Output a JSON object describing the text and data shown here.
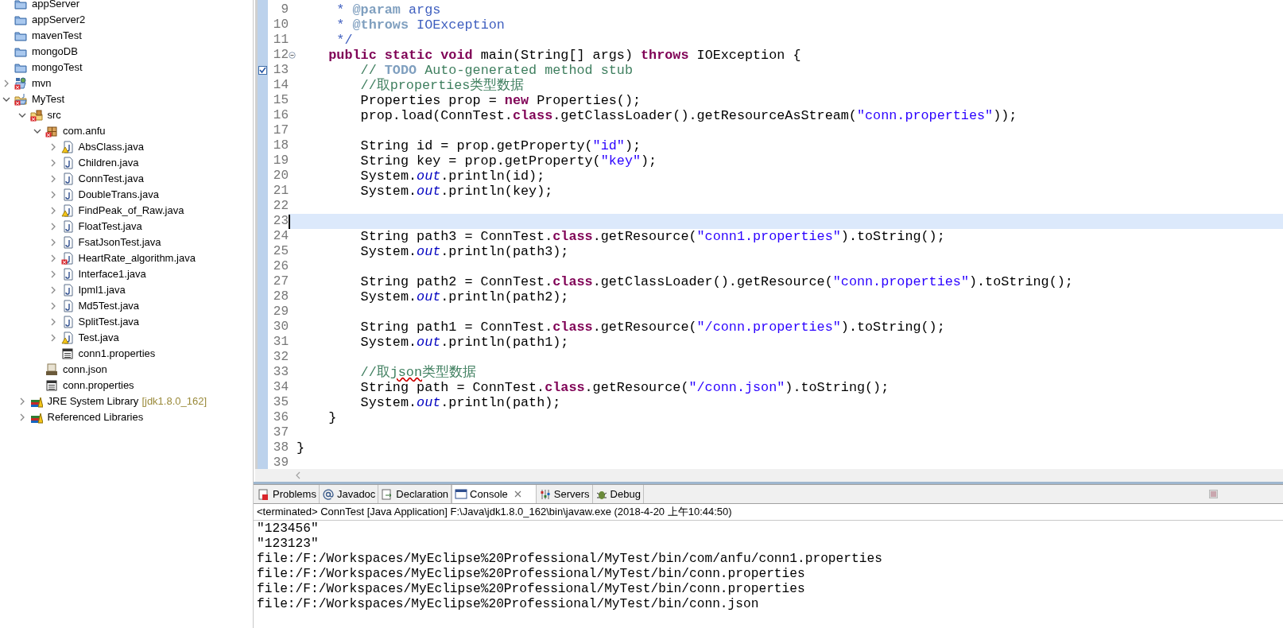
{
  "tree": [
    {
      "label": "appServer",
      "kind": "closed_project",
      "error": false,
      "warning": false
    },
    {
      "label": "appServer2",
      "kind": "closed_project",
      "error": false,
      "warning": false
    },
    {
      "label": "mavenTest",
      "kind": "closed_project",
      "error": false,
      "warning": false
    },
    {
      "label": "mongoDB",
      "kind": "closed_project",
      "error": false,
      "warning": false
    },
    {
      "label": "mongoTest",
      "kind": "closed_project",
      "error": false,
      "warning": false
    },
    {
      "label": "mvn",
      "kind": "maven_project",
      "error": true,
      "warning": false,
      "expanded": false
    },
    {
      "label": "MyTest",
      "kind": "java_project",
      "error": true,
      "warning": false,
      "expanded": true,
      "children": [
        {
          "label": "src",
          "kind": "source_folder",
          "error": true,
          "warning": false,
          "expanded": true,
          "children": [
            {
              "label": "com.anfu",
              "kind": "package",
              "error": true,
              "warning": false,
              "expanded": true,
              "children": [
                {
                  "label": "AbsClass.java",
                  "kind": "java",
                  "error": false,
                  "warning": true,
                  "expanded": false
                },
                {
                  "label": "Children.java",
                  "kind": "java",
                  "error": false,
                  "warning": false,
                  "expanded": false
                },
                {
                  "label": "ConnTest.java",
                  "kind": "java",
                  "error": false,
                  "warning": false,
                  "expanded": false
                },
                {
                  "label": "DoubleTrans.java",
                  "kind": "java",
                  "error": false,
                  "warning": false,
                  "expanded": false
                },
                {
                  "label": "FindPeak_of_Raw.java",
                  "kind": "java",
                  "error": false,
                  "warning": true,
                  "expanded": false
                },
                {
                  "label": "FloatTest.java",
                  "kind": "java",
                  "error": false,
                  "warning": false,
                  "expanded": false
                },
                {
                  "label": "FsatJsonTest.java",
                  "kind": "java",
                  "error": false,
                  "warning": false,
                  "expanded": false
                },
                {
                  "label": "HeartRate_algorithm.java",
                  "kind": "java",
                  "error": true,
                  "warning": false,
                  "expanded": false
                },
                {
                  "label": "Interface1.java",
                  "kind": "java",
                  "error": false,
                  "warning": false,
                  "expanded": false
                },
                {
                  "label": "Ipml1.java",
                  "kind": "java",
                  "error": false,
                  "warning": false,
                  "expanded": false
                },
                {
                  "label": "Md5Test.java",
                  "kind": "java",
                  "error": false,
                  "warning": false,
                  "expanded": false
                },
                {
                  "label": "SplitTest.java",
                  "kind": "java",
                  "error": false,
                  "warning": false,
                  "expanded": false
                },
                {
                  "label": "Test.java",
                  "kind": "java",
                  "error": false,
                  "warning": true,
                  "expanded": false
                },
                {
                  "label": "conn1.properties",
                  "kind": "properties",
                  "error": false,
                  "warning": false
                }
              ]
            },
            {
              "label": "conn.json",
              "kind": "json",
              "error": false,
              "warning": false
            },
            {
              "label": "conn.properties",
              "kind": "properties",
              "error": false,
              "warning": false
            }
          ]
        },
        {
          "label": "JRE System Library",
          "decoration": "[jdk1.8.0_162]",
          "kind": "library",
          "error": false,
          "warning": false,
          "expanded": false
        },
        {
          "label": "Referenced Libraries",
          "kind": "library",
          "error": false,
          "warning": false,
          "expanded": false
        }
      ]
    }
  ],
  "editor": {
    "lines": [
      {
        "n": "9",
        "current": false,
        "tokens": [
          {
            "kind": "javadoc",
            "text": "     * "
          },
          {
            "kind": "javadoc_tag",
            "text": "@param"
          },
          {
            "kind": "javadoc",
            "text": " args"
          }
        ]
      },
      {
        "n": "10",
        "current": false,
        "tokens": [
          {
            "kind": "javadoc",
            "text": "     * "
          },
          {
            "kind": "javadoc_tag",
            "text": "@throws"
          },
          {
            "kind": "javadoc",
            "text": " IOException"
          }
        ]
      },
      {
        "n": "11",
        "current": false,
        "tokens": [
          {
            "kind": "javadoc",
            "text": "     */"
          }
        ]
      },
      {
        "n": "12",
        "current": false,
        "annotation": {
          "kind": "fold"
        },
        "tokens": [
          {
            "kind": "keyword",
            "text": "    public static void"
          },
          {
            "kind": "plain",
            "text": " main(String[] args) "
          },
          {
            "kind": "keyword",
            "text": "throws"
          },
          {
            "kind": "plain",
            "text": " IOException {"
          }
        ]
      },
      {
        "n": "13",
        "current": false,
        "annotation": {
          "kind": "task"
        },
        "tokens": [
          {
            "kind": "comment",
            "text": "        // "
          },
          {
            "kind": "task_tag",
            "text": "TODO"
          },
          {
            "kind": "comment",
            "text": " Auto-generated method stub"
          }
        ]
      },
      {
        "n": "14",
        "current": false,
        "tokens": [
          {
            "kind": "comment",
            "text": "        //取properties类型数据"
          }
        ]
      },
      {
        "n": "15",
        "current": false,
        "tokens": [
          {
            "kind": "plain",
            "text": "        Properties prop = "
          },
          {
            "kind": "keyword",
            "text": "new"
          },
          {
            "kind": "plain",
            "text": " Properties();"
          }
        ]
      },
      {
        "n": "16",
        "current": false,
        "tokens": [
          {
            "kind": "plain",
            "text": "        prop.load(ConnTest."
          },
          {
            "kind": "keyword",
            "text": "class"
          },
          {
            "kind": "plain",
            "text": ".getClassLoader().getResourceAsStream("
          },
          {
            "kind": "string",
            "text": "\"conn.properties\""
          },
          {
            "kind": "plain",
            "text": "));"
          }
        ]
      },
      {
        "n": "17",
        "current": false
      },
      {
        "n": "18",
        "current": false,
        "tokens": [
          {
            "kind": "plain",
            "text": "        String id = prop.getProperty("
          },
          {
            "kind": "string",
            "text": "\"id\""
          },
          {
            "kind": "plain",
            "text": ");"
          }
        ]
      },
      {
        "n": "19",
        "current": false,
        "tokens": [
          {
            "kind": "plain",
            "text": "        String key = prop.getProperty("
          },
          {
            "kind": "string",
            "text": "\"key\""
          },
          {
            "kind": "plain",
            "text": ");"
          }
        ]
      },
      {
        "n": "20",
        "current": false,
        "tokens": [
          {
            "kind": "plain",
            "text": "        System."
          },
          {
            "kind": "field",
            "text": "out"
          },
          {
            "kind": "plain",
            "text": ".println(id);"
          }
        ]
      },
      {
        "n": "21",
        "current": false,
        "tokens": [
          {
            "kind": "plain",
            "text": "        System."
          },
          {
            "kind": "field",
            "text": "out"
          },
          {
            "kind": "plain",
            "text": ".println(key);"
          }
        ]
      },
      {
        "n": "22",
        "current": false
      },
      {
        "n": "23",
        "current": true
      },
      {
        "n": "24",
        "current": false,
        "tokens": [
          {
            "kind": "plain",
            "text": "        String path3 = ConnTest."
          },
          {
            "kind": "keyword",
            "text": "class"
          },
          {
            "kind": "plain",
            "text": ".getResource("
          },
          {
            "kind": "string",
            "text": "\"conn1.properties\""
          },
          {
            "kind": "plain",
            "text": ").toString();"
          }
        ]
      },
      {
        "n": "25",
        "current": false,
        "tokens": [
          {
            "kind": "plain",
            "text": "        System."
          },
          {
            "kind": "field",
            "text": "out"
          },
          {
            "kind": "plain",
            "text": ".println(path3);"
          }
        ]
      },
      {
        "n": "26",
        "current": false
      },
      {
        "n": "27",
        "current": false,
        "tokens": [
          {
            "kind": "plain",
            "text": "        String path2 = ConnTest."
          },
          {
            "kind": "keyword",
            "text": "class"
          },
          {
            "kind": "plain",
            "text": ".getClassLoader().getResource("
          },
          {
            "kind": "string",
            "text": "\"conn.properties\""
          },
          {
            "kind": "plain",
            "text": ").toString();"
          }
        ]
      },
      {
        "n": "28",
        "current": false,
        "tokens": [
          {
            "kind": "plain",
            "text": "        System."
          },
          {
            "kind": "field",
            "text": "out"
          },
          {
            "kind": "plain",
            "text": ".println(path2);"
          }
        ]
      },
      {
        "n": "29",
        "current": false
      },
      {
        "n": "30",
        "current": false,
        "tokens": [
          {
            "kind": "plain",
            "text": "        String path1 = ConnTest."
          },
          {
            "kind": "keyword",
            "text": "class"
          },
          {
            "kind": "plain",
            "text": ".getResource("
          },
          {
            "kind": "string",
            "text": "\"/conn.properties\""
          },
          {
            "kind": "plain",
            "text": ").toString();"
          }
        ]
      },
      {
        "n": "31",
        "current": false,
        "tokens": [
          {
            "kind": "plain",
            "text": "        System."
          },
          {
            "kind": "field",
            "text": "out"
          },
          {
            "kind": "plain",
            "text": ".println(path1);"
          }
        ]
      },
      {
        "n": "32",
        "current": false
      },
      {
        "n": "33",
        "current": false,
        "tokens": [
          {
            "kind": "comment",
            "text": "        //取"
          },
          {
            "kind": "spell",
            "text": "json"
          },
          {
            "kind": "comment",
            "text": "类型数据"
          }
        ]
      },
      {
        "n": "34",
        "current": false,
        "tokens": [
          {
            "kind": "plain",
            "text": "        String path = ConnTest."
          },
          {
            "kind": "keyword",
            "text": "class"
          },
          {
            "kind": "plain",
            "text": ".getResource("
          },
          {
            "kind": "string",
            "text": "\"/conn.json\""
          },
          {
            "kind": "plain",
            "text": ").toString();"
          }
        ]
      },
      {
        "n": "35",
        "current": false,
        "tokens": [
          {
            "kind": "plain",
            "text": "        System."
          },
          {
            "kind": "field",
            "text": "out"
          },
          {
            "kind": "plain",
            "text": ".println(path);"
          }
        ]
      },
      {
        "n": "36",
        "current": false,
        "tokens": [
          {
            "kind": "plain",
            "text": "    }"
          }
        ]
      },
      {
        "n": "37",
        "current": false
      },
      {
        "n": "38",
        "current": false,
        "tokens": [
          {
            "kind": "plain",
            "text": "}"
          }
        ]
      },
      {
        "n": "39",
        "current": false
      }
    ]
  },
  "console": {
    "tabs": [
      {
        "label": "Problems",
        "selected": false
      },
      {
        "label": "Javadoc",
        "selected": false
      },
      {
        "label": "Declaration",
        "selected": false
      },
      {
        "label": "Console",
        "selected": true
      },
      {
        "label": "Servers",
        "selected": false
      },
      {
        "label": "Debug",
        "selected": false
      }
    ],
    "header": "<terminated> ConnTest [Java Application] F:\\Java\\jdk1.8.0_162\\bin\\javaw.exe (2018-4-20 上午10:44:50)",
    "output": [
      "\"123456\"",
      "\"123123\"",
      "file:/F:/Workspaces/MyEclipse%20Professional/MyTest/bin/com/anfu/conn1.properties",
      "file:/F:/Workspaces/MyEclipse%20Professional/MyTest/bin/conn.properties",
      "file:/F:/Workspaces/MyEclipse%20Professional/MyTest/bin/conn.properties",
      "file:/F:/Workspaces/MyEclipse%20Professional/MyTest/bin/conn.json"
    ]
  }
}
